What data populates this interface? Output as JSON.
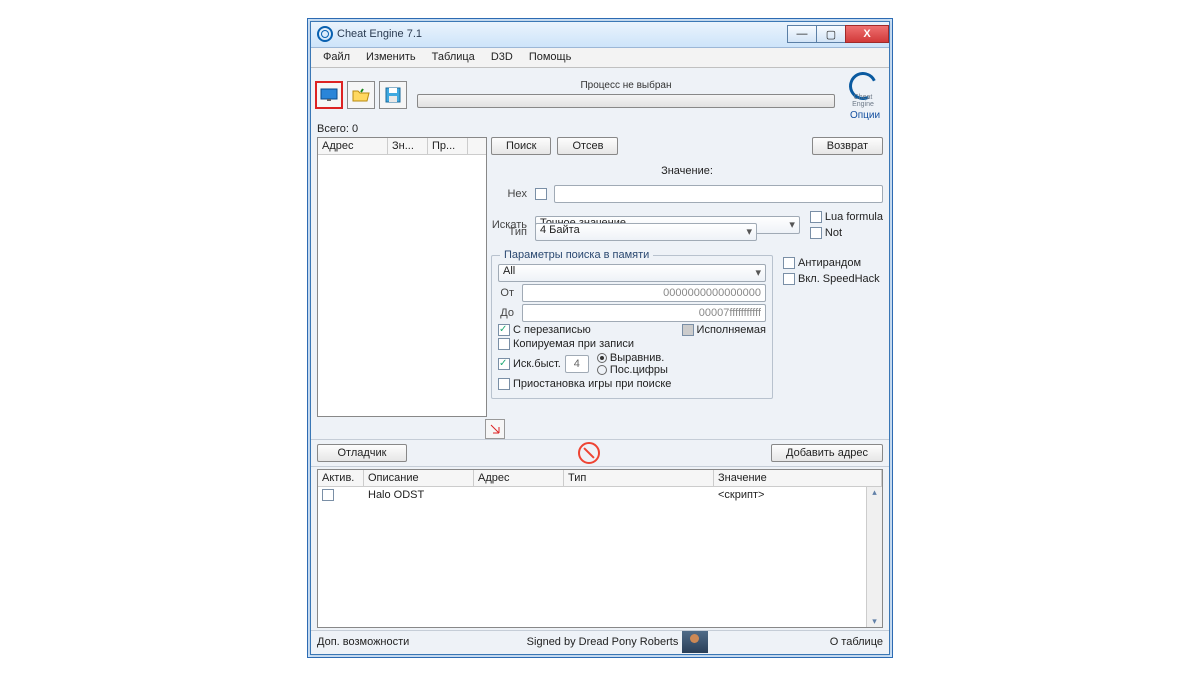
{
  "window": {
    "title": "Cheat Engine 7.1"
  },
  "menu": {
    "file": "Файл",
    "edit": "Изменить",
    "table": "Таблица",
    "d3d": "D3D",
    "help": "Помощь"
  },
  "toolbar": {
    "process_label": "Процесс не выбран",
    "options": "Опции",
    "logo_caption": "Cheat Engine"
  },
  "total": {
    "label": "Всего:",
    "value": "0"
  },
  "addrlist": {
    "hdr_address": "Адрес",
    "hdr_val": "Зн...",
    "hdr_prev": "Пр..."
  },
  "search": {
    "first_scan": "Поиск",
    "filter": "Отсев",
    "undo": "Возврат",
    "value_label": "Значение:",
    "hex_label": "Hex",
    "scan_label": "Искать",
    "scan_type": "Точное значение",
    "value_type_label": "Тип",
    "value_type": "4 Байта",
    "lua_formula": "Lua formula",
    "not": "Not"
  },
  "memopts": {
    "legend": "Параметры поиска в памяти",
    "region": "All",
    "from_label": "От",
    "to_label": "До",
    "from": "0000000000000000",
    "to": "00007fffffffffff",
    "writable": "С перезаписью",
    "executable": "Исполняемая",
    "copy_on_write": "Копируемая при записи",
    "fast_scan": "Иск.быст.",
    "fast_value": "4",
    "opt_align": "Выравнив.",
    "opt_last_digits": "Пос.цифры",
    "pause": "Приостановка игры при поиске",
    "antirandom": "Антирандом",
    "speedhack": "Вкл. SpeedHack"
  },
  "mid": {
    "debugger": "Отладчик",
    "add_address": "Добавить адрес"
  },
  "tbl": {
    "hdr_active": "Актив.",
    "hdr_desc": "Описание",
    "hdr_addr": "Адрес",
    "hdr_type": "Тип",
    "hdr_val": "Значение",
    "row0_desc": "Halo ODST",
    "row0_val": "<скрипт>"
  },
  "status": {
    "extra": "Доп. возможности",
    "signed": "Signed by Dread Pony Roberts",
    "about": "О таблице"
  }
}
